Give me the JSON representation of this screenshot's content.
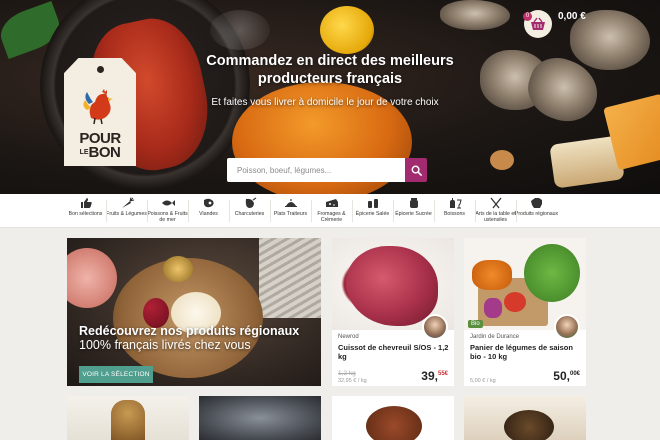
{
  "hero": {
    "headline": "Commandez en direct des meilleurs producteurs français",
    "subline": "Et faites vous livrer à domicile le jour de votre choix",
    "search_placeholder": "Poisson, boeuf, légumes...",
    "logo_line1": "POUR",
    "logo_small": "LE",
    "logo_line2": "BON"
  },
  "cart": {
    "count": "0",
    "total": "0,00 €"
  },
  "nav": {
    "items": [
      {
        "label": "Bon sélections",
        "icon": "thumbs-up-icon"
      },
      {
        "label": "Fruits & Légumes",
        "icon": "carrot-icon"
      },
      {
        "label": "Poissons & Fruits de mer",
        "icon": "fish-icon"
      },
      {
        "label": "Viandes",
        "icon": "meat-icon"
      },
      {
        "label": "Charcuteries",
        "icon": "ham-icon"
      },
      {
        "label": "Plats Traiteurs",
        "icon": "dish-icon"
      },
      {
        "label": "Fromages & Crèmerie",
        "icon": "cheese-icon"
      },
      {
        "label": "Épicerie Salée",
        "icon": "salt-icon"
      },
      {
        "label": "Épicerie Sucrée",
        "icon": "honey-icon"
      },
      {
        "label": "Boissons",
        "icon": "bottle-icon"
      },
      {
        "label": "Arts de la table et ustensiles",
        "icon": "cutlery-icon"
      },
      {
        "label": "Produits régionaux",
        "icon": "france-map-icon"
      }
    ]
  },
  "promo": {
    "title": "Redécouvrez nos produits régionaux",
    "subtitle": "100% français livrés chez vous",
    "button": "VOIR LA SÉLECTION"
  },
  "products": [
    {
      "seller": "Newrod",
      "name": "Cuissot de chevreuil S/OS - 1,2 kg",
      "old_price": "1,2 kg",
      "unit_price": "32,95 € / kg",
      "price_int": "39,",
      "price_dec": "55€"
    },
    {
      "badge": "Bio",
      "seller": "Jardin de Durance",
      "name": "Panier de légumes de saison bio - 10 kg",
      "unit_price": "5,00 € / kg",
      "price_int": "50,",
      "price_dec": "00€"
    }
  ],
  "colors": {
    "accent": "#a22a6e",
    "button_teal": "#4f9e8e",
    "page_bg": "#efeeea"
  }
}
